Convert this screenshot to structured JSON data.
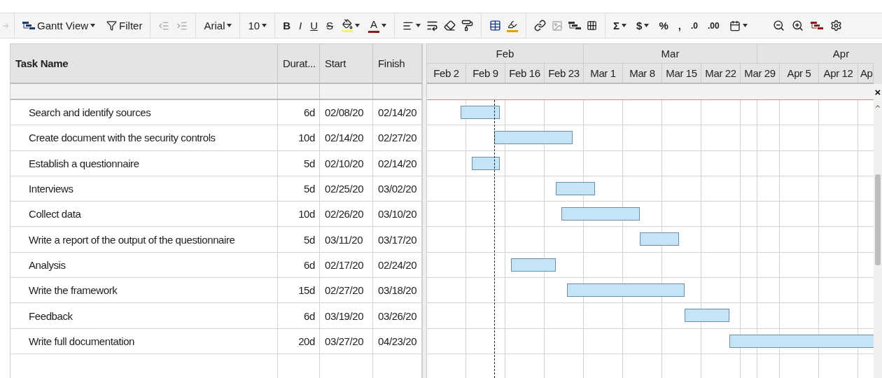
{
  "toolbar": {
    "view_menu": "Gantt View",
    "filter": "Filter",
    "font": "Arial",
    "font_size": "10",
    "bold": "B",
    "italic": "I",
    "underline": "U",
    "strikethrough": "S",
    "text_color": "A",
    "sum": "Σ",
    "currency": "$",
    "percent": "%",
    "comma": ",",
    "decimal_decrease": ".0",
    "decimal_increase": ".00"
  },
  "table": {
    "columns": [
      "Task Name",
      "Durat...",
      "Start",
      "Finish"
    ],
    "rows": [
      {
        "task": "Search and identify sources",
        "duration": "6d",
        "start": "02/08/20",
        "finish": "02/14/20"
      },
      {
        "task": "Create document with the security controls",
        "duration": "10d",
        "start": "02/14/20",
        "finish": "02/27/20"
      },
      {
        "task": "Establish a questionnaire",
        "duration": "5d",
        "start": "02/10/20",
        "finish": "02/14/20"
      },
      {
        "task": "Interviews",
        "duration": "5d",
        "start": "02/25/20",
        "finish": "03/02/20"
      },
      {
        "task": "Collect data",
        "duration": "10d",
        "start": "02/26/20",
        "finish": "03/10/20"
      },
      {
        "task": "Write a report of the output of the questionnaire",
        "duration": "5d",
        "start": "03/11/20",
        "finish": "03/17/20"
      },
      {
        "task": "Analysis",
        "duration": "6d",
        "start": "02/17/20",
        "finish": "02/24/20"
      },
      {
        "task": "Write the framework",
        "duration": "15d",
        "start": "02/27/20",
        "finish": "03/18/20"
      },
      {
        "task": "Feedback",
        "duration": "6d",
        "start": "03/19/20",
        "finish": "03/26/20"
      },
      {
        "task": "Write full documentation",
        "duration": "20d",
        "start": "03/27/20",
        "finish": "04/23/20"
      }
    ]
  },
  "gantt": {
    "months": [
      "Feb",
      "Mar",
      "Apr"
    ],
    "weeks": [
      "Feb 2",
      "Feb 9",
      "Feb 16",
      "Feb 23",
      "Mar 1",
      "Mar 8",
      "Mar 15",
      "Mar 22",
      "Mar 29",
      "Apr 5",
      "Apr 12",
      "Ap"
    ],
    "close_glyph": "×"
  }
}
